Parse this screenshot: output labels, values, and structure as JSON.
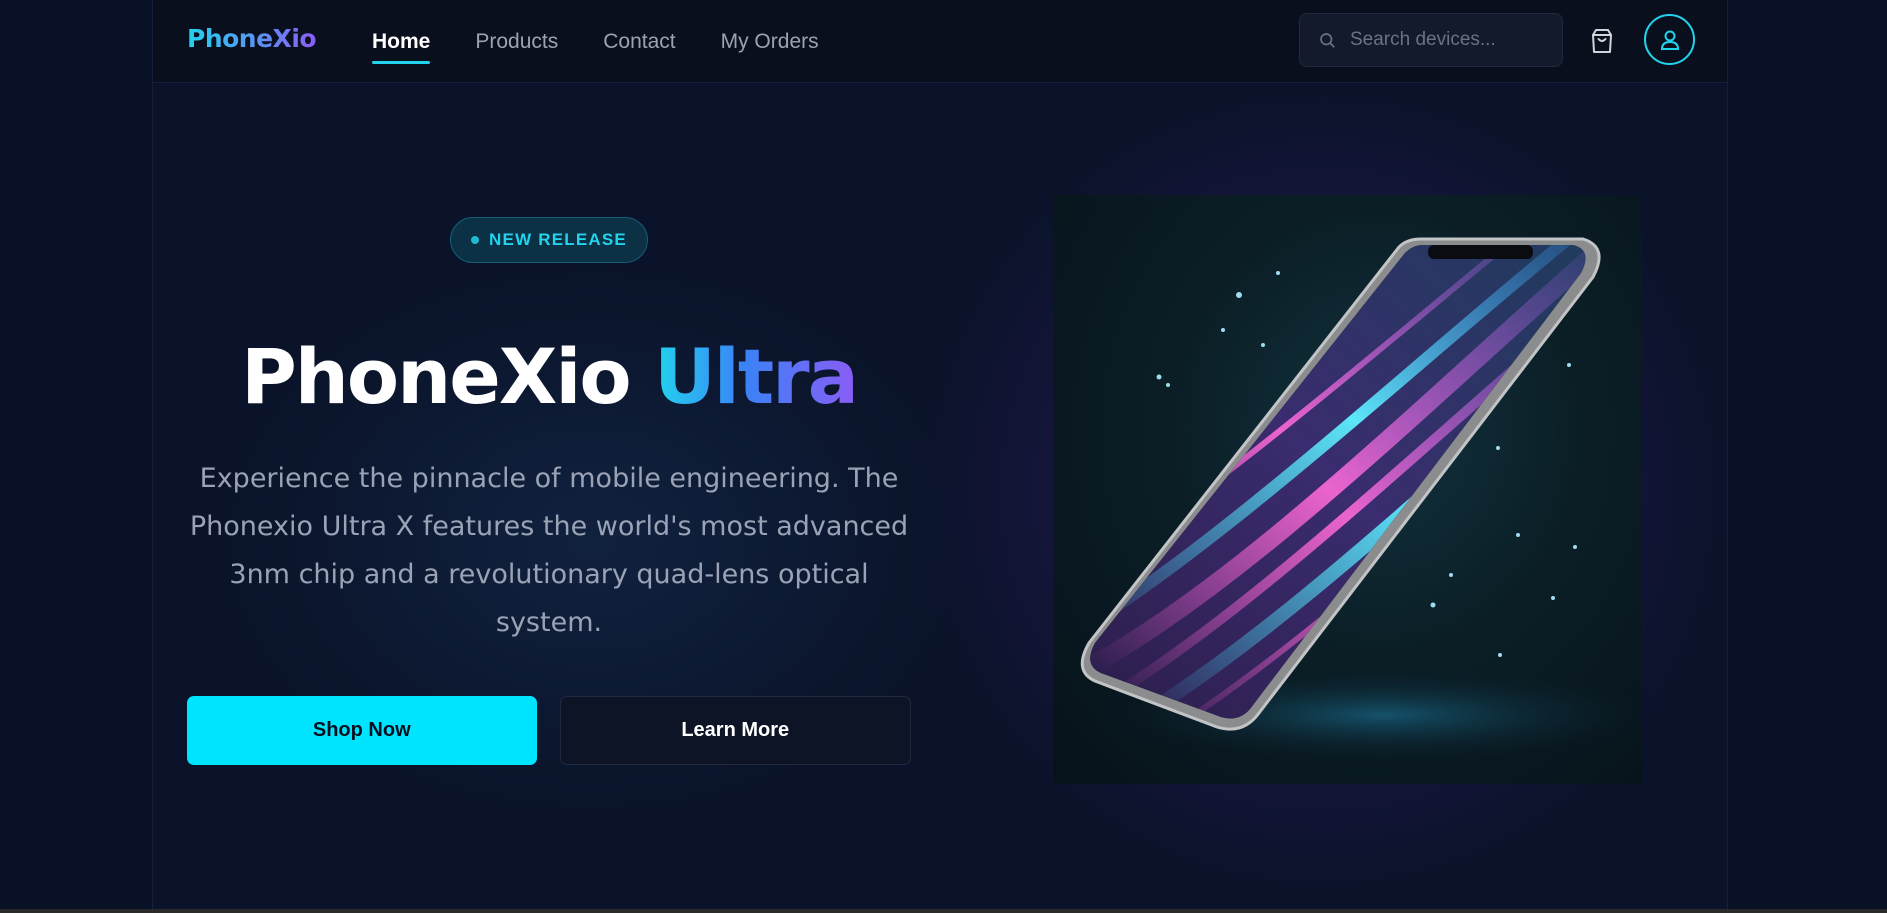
{
  "header": {
    "logo": "PhoneXio",
    "nav": [
      {
        "label": "Home",
        "active": true
      },
      {
        "label": "Products",
        "active": false
      },
      {
        "label": "Contact",
        "active": false
      },
      {
        "label": "My Orders",
        "active": false
      }
    ],
    "search": {
      "placeholder": "Search devices...",
      "value": "",
      "icon": "search-icon"
    },
    "cart_icon": "shopping-bag-icon",
    "profile_icon": "user-icon"
  },
  "hero": {
    "badge": "NEW RELEASE",
    "title_main": "PhoneXio",
    "title_accent": "Ultra",
    "description": "Experience the pinnacle of mobile engineering. The Phonexio Ultra X features the world's most advanced 3nm chip and a revolutionary quad-lens optical system.",
    "primary_cta": "Shop Now",
    "secondary_cta": "Learn More"
  },
  "colors": {
    "accent": "#00e5ff",
    "brand_gradient_start": "#22d3ee",
    "brand_gradient_end": "#8b5cf6",
    "background": "#0a1329"
  }
}
